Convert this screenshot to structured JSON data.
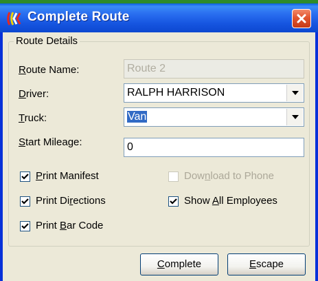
{
  "window": {
    "title": "Complete Route"
  },
  "group": {
    "legend": "Route Details"
  },
  "fields": {
    "route_name": {
      "label_pre": "",
      "label_key": "R",
      "label_post": "oute Name:",
      "value": "Route 2"
    },
    "driver": {
      "label_pre": "",
      "label_key": "D",
      "label_post": "river:",
      "value": "RALPH HARRISON"
    },
    "truck": {
      "label_pre": "",
      "label_key": "T",
      "label_post": "ruck:",
      "value": "Van"
    },
    "start_mileage": {
      "label_pre": "",
      "label_key": "S",
      "label_post": "tart Mileage:",
      "value": "0"
    }
  },
  "checkboxes": {
    "print_manifest": {
      "pre": "",
      "key": "P",
      "post": "rint Manifest",
      "checked": true
    },
    "print_directions": {
      "pre": "Print Di",
      "key": "r",
      "post": "ections",
      "checked": true
    },
    "print_bar_code": {
      "pre": "Print ",
      "key": "B",
      "post": "ar Code",
      "checked": true
    },
    "download_to_phone": {
      "pre": "Dow",
      "key": "n",
      "post": "load to Phone",
      "checked": false
    },
    "show_all_employees": {
      "pre": "Show ",
      "key": "A",
      "post": "ll Employees",
      "checked": true
    }
  },
  "buttons": {
    "complete": {
      "key": "C",
      "post": "omplete"
    },
    "escape": {
      "key": "E",
      "post": "scape"
    }
  },
  "icons": {
    "app": "route-app-icon",
    "close": "close-icon",
    "dropdown": "chevron-down-icon",
    "check": "checkmark-icon"
  },
  "colors": {
    "titlebar": "#0a5fe0",
    "client_bg": "#ece9d8",
    "selection": "#316ac5",
    "close_button": "#e2552f"
  }
}
